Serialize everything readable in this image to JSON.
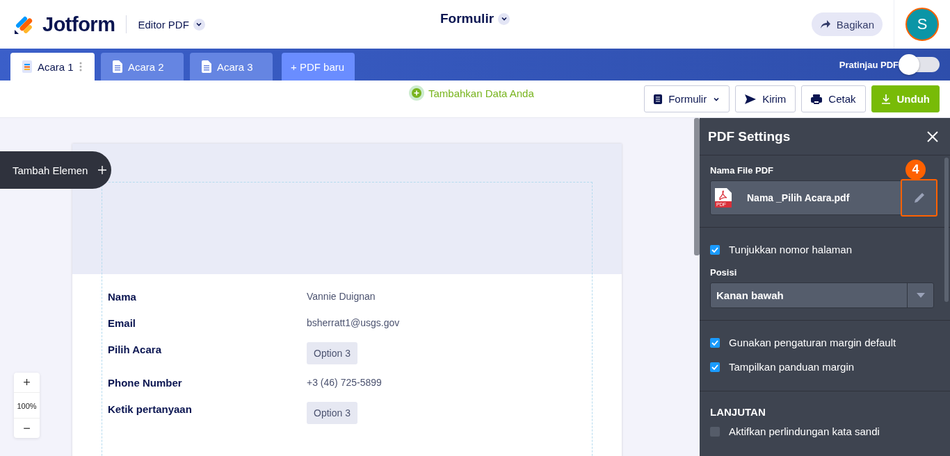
{
  "header": {
    "brand": "Jotform",
    "product": "Editor PDF",
    "title": "Formulir",
    "share_button": "Bagikan",
    "avatar": "S"
  },
  "tabs": [
    {
      "label": "Acara 1",
      "selected": true
    },
    {
      "label": "Acara 2",
      "selected": false
    },
    {
      "label": "Acara 3",
      "selected": false
    }
  ],
  "new_pdf_button": "+ PDF baru",
  "preview_toggle": {
    "label": "Pratinjau PDF",
    "on": false
  },
  "toolbar": {
    "add_data": "Tambahkan Data Anda",
    "buttons": [
      {
        "label": "Formulir",
        "kind": "dropdown"
      },
      {
        "label": "Kirim",
        "kind": "send"
      },
      {
        "label": "Cetak",
        "kind": "print"
      },
      {
        "label": "Unduh",
        "kind": "download"
      }
    ]
  },
  "add_element": "Tambah Elemen",
  "zoom": {
    "in": "+",
    "level": "100%",
    "out": "−"
  },
  "fields": [
    {
      "label": "Nama",
      "value": "Vannie Duignan",
      "kind": "text"
    },
    {
      "label": "Email",
      "value": "bsherratt1@usgs.gov",
      "kind": "text"
    },
    {
      "label": "Pilih Acara",
      "value": "Option 3",
      "kind": "option"
    },
    {
      "label": "Phone Number",
      "value": "+3 (46) 725-5899",
      "kind": "text"
    },
    {
      "label": "Ketik pertanyaan",
      "value": "Option 3",
      "kind": "option"
    }
  ],
  "settings_panel": {
    "title": "PDF Settings",
    "file_label": "Nama File PDF",
    "file_name": "Nama _Pilih Acara.pdf",
    "file_badge": "PDF",
    "annotation": "4",
    "page_number": {
      "label": "Tunjukkan nomor halaman",
      "checked": true
    },
    "position": {
      "label": "Posisi",
      "value": "Kanan bawah"
    },
    "margin_options": [
      {
        "label": "Gunakan pengaturan margin default",
        "checked": true
      },
      {
        "label": "Tampilkan panduan margin",
        "checked": true
      }
    ],
    "advanced_title": "LANJUTAN",
    "advanced_options": [
      {
        "label": "Aktifkan perlindungan kata sandi",
        "checked": false
      }
    ]
  }
}
